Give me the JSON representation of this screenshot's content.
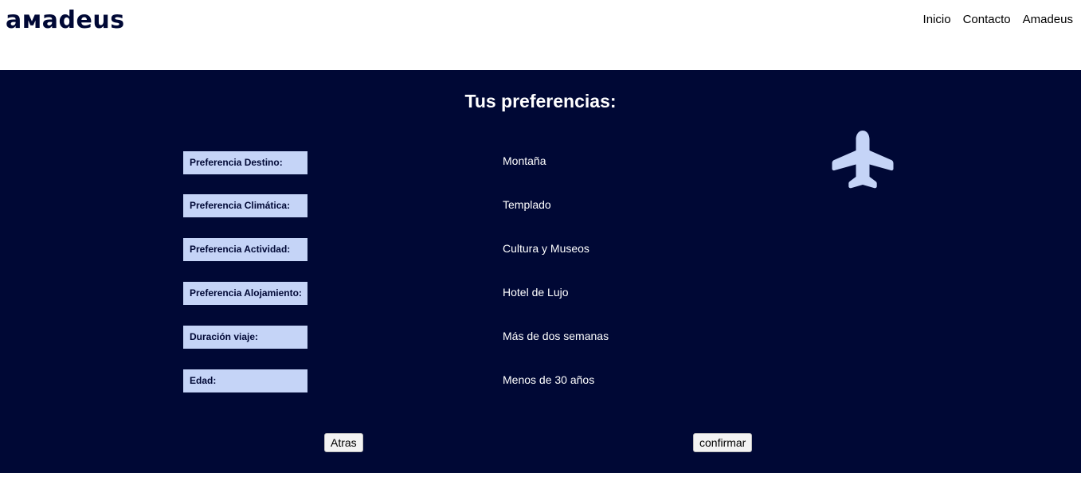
{
  "header": {
    "logo": "aмadeus",
    "nav": [
      "Inicio",
      "Contacto",
      "Amadeus"
    ]
  },
  "main": {
    "title": "Tus preferencias:",
    "rows": [
      {
        "label": "Preferencia Destino:",
        "value": "Montaña"
      },
      {
        "label": "Preferencia Climática:",
        "value": "Templado"
      },
      {
        "label": "Preferencia Actividad:",
        "value": "Cultura y Museos"
      },
      {
        "label": "Preferencia Alojamiento:",
        "value": "Hotel de Lujo"
      },
      {
        "label": "Duración viaje:",
        "value": "Más de dos semanas"
      },
      {
        "label": "Edad:",
        "value": "Menos de 30 años"
      }
    ],
    "icon": "airplane-icon",
    "buttons": {
      "back": "Atras",
      "confirm": "confirmar"
    }
  },
  "colors": {
    "brand": "#000835",
    "label_bg": "#c5d4f7",
    "icon": "#c5d4f7"
  }
}
